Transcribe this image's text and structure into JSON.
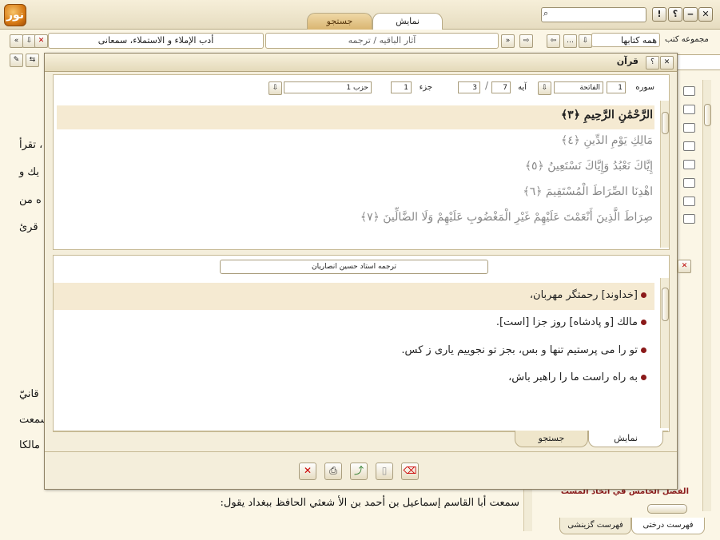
{
  "app": {
    "logo": "نور",
    "tabs": [
      {
        "label": "نمایش",
        "active": true
      },
      {
        "label": "جستجو",
        "active": false
      }
    ],
    "window_buttons": [
      "✕",
      "‒",
      "؟",
      "!"
    ]
  },
  "address": {
    "book_title": "أدب الإملاء و الاستملاء، سمعانی",
    "path": "آثار الباقیه / ترجمه",
    "collection_label": "مجموعه کتب",
    "collection_value": "همه کتابها"
  },
  "background_text": {
    "fragments_left": [
      "، تقرأ",
      "يك و",
      "ه من",
      "قرئ",
      "قانيّ",
      "سمعت",
      "مالكا"
    ],
    "bottom_line": "سمعت أبا القاسم إسماعيل بن أحمد بن الأ شعثي الحافظ ببغداد يقول:"
  },
  "sidebar": {
    "highlighted_item": "الفصل الخامس في اتخاذ المست",
    "bottom_tabs": [
      "فهرست درختی",
      "فهرست گزینشی"
    ]
  },
  "dialog": {
    "title": "قرآن",
    "selector": {
      "surah_label": "سوره",
      "surah_number": "1",
      "surah_name": "الفاتحة",
      "ayah_label": "آيه",
      "ayah_from": "7",
      "ayah_to": "3",
      "juz_label": "جزء",
      "juz_value": "1",
      "hizb_value": "حزب 1"
    },
    "verses": [
      {
        "text": "الرَّحْمَٰنِ الرَّحِيمِ ﴿٣﴾",
        "highlighted": true
      },
      {
        "text": "مَالِكِ يَوْمِ الدِّينِ ﴿٤﴾",
        "highlighted": false
      },
      {
        "text": "إِيَّاكَ نَعْبُدُ وَإِيَّاكَ نَسْتَعِينُ ﴿٥﴾",
        "highlighted": false
      },
      {
        "text": "اهْدِنَا الصِّرَاطَ الْمُسْتَقِيمَ ﴿٦﴾",
        "highlighted": false
      },
      {
        "text": "صِرَاطَ الَّذِينَ أَنْعَمْتَ عَلَيْهِمْ غَيْرِ الْمَغْضُوبِ عَلَيْهِمْ وَلَا الضَّالِّينَ ﴿٧﴾",
        "highlighted": false
      }
    ],
    "translator": "ترجمه استاد حسین انصاریان",
    "translations": [
      {
        "text": "[خداوند] رحمتگر مهربان،",
        "highlighted": true
      },
      {
        "text": "مالك [و پادشاه] روز جزا [است].",
        "highlighted": false
      },
      {
        "text": "تو را می پرستیم تنها و بس، بجز تو نجوییم یاری ز کس.",
        "highlighted": false
      },
      {
        "text": "به راه راست ما را راهبر باش،",
        "highlighted": false
      }
    ],
    "bottom_tabs": [
      {
        "label": "نمایش",
        "active": true
      },
      {
        "label": "جستجو",
        "active": false
      }
    ],
    "actions": [
      "close",
      "print",
      "export",
      "copy",
      "remove"
    ]
  },
  "colors": {
    "accent": "#d77a14",
    "dot": "#8b1a1a",
    "highlight": "#f5ead2"
  }
}
